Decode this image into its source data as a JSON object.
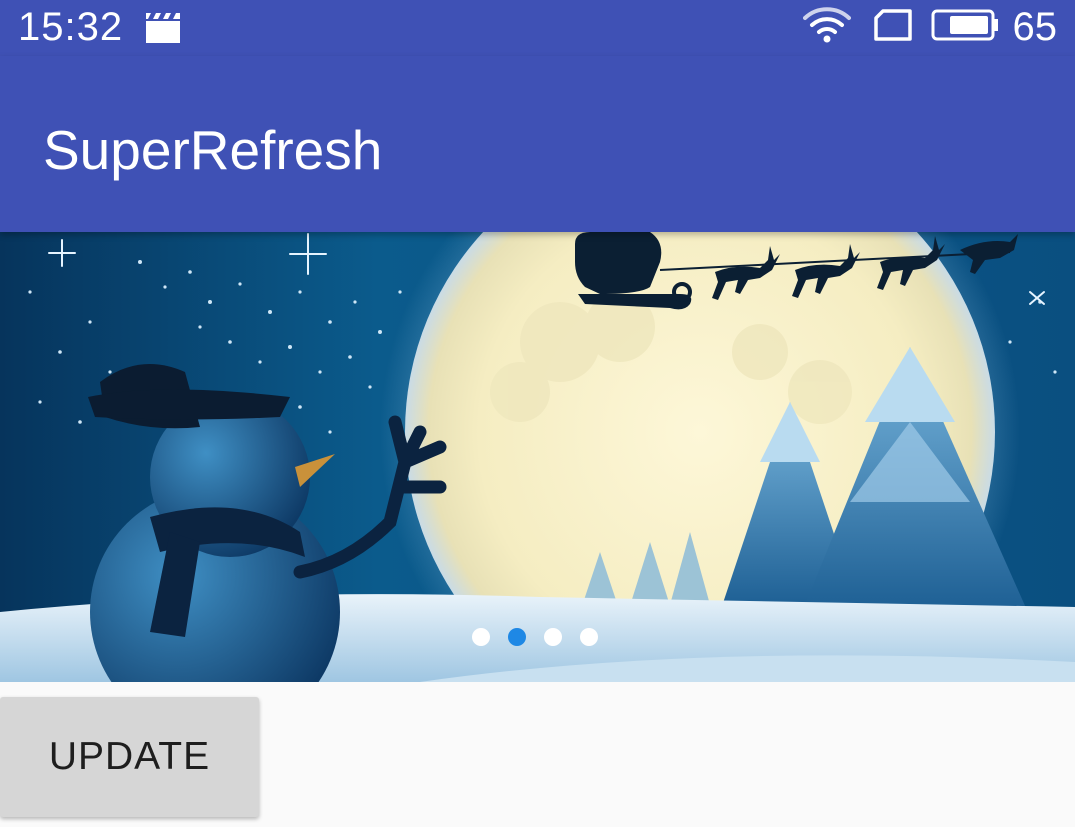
{
  "status_bar": {
    "time": "15:32",
    "battery_level": "65",
    "icons": [
      "clapper-icon",
      "wifi-icon",
      "sim-card-icon",
      "battery-icon"
    ]
  },
  "app_bar": {
    "title": "SuperRefresh",
    "color": "#3f51b5"
  },
  "banner": {
    "image": "christmas-night-snowman-santa-sleigh-moon",
    "page_indicator": {
      "count": 4,
      "active_index": 1,
      "active_color": "#1e88e5",
      "inactive_color": "#ffffff"
    }
  },
  "actions": {
    "update_label": "UPDATE"
  }
}
